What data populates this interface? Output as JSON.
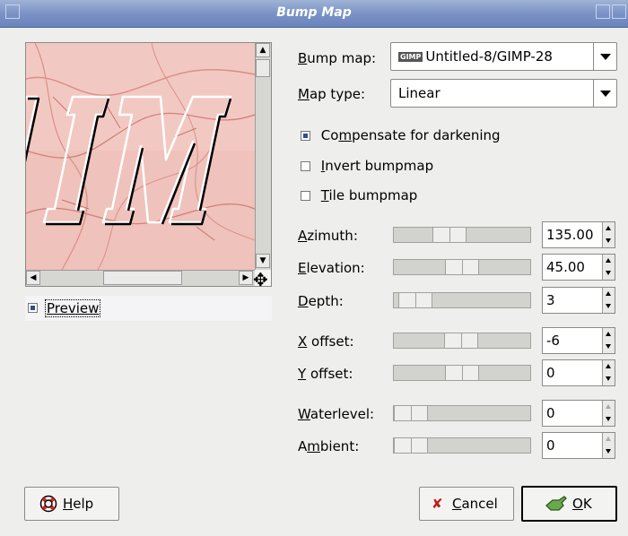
{
  "window": {
    "title": "Bump Map"
  },
  "preview": {
    "label": "Preview",
    "checked": true,
    "image_text": "IM"
  },
  "bump_map": {
    "label": "Bump map:",
    "label_key": "B",
    "label_rest": "ump map:",
    "badge": "GIMP",
    "value": "Untitled-8/GIMP-28"
  },
  "map_type": {
    "label_key": "M",
    "label_rest": "ap type:",
    "value": "Linear"
  },
  "options": {
    "compensate": {
      "pre": "Co",
      "key": "m",
      "post": "pensate for darkening",
      "checked": true
    },
    "invert": {
      "pre": "",
      "key": "I",
      "post": "nvert bumpmap",
      "checked": false
    },
    "tile": {
      "pre": "",
      "key": "T",
      "post": "ile bumpmap",
      "checked": false
    }
  },
  "params": {
    "azimuth": {
      "key": "A",
      "rest": "zimuth:",
      "value": "135.00",
      "fraction": 0.375
    },
    "elevation": {
      "key": "E",
      "rest": "levation:",
      "value": "45.00",
      "fraction": 0.5
    },
    "depth": {
      "key": "D",
      "rest": "epth:",
      "value": "3",
      "fraction": 0.04
    },
    "x_offset": {
      "key": "X",
      "rest": " offset:",
      "value": "-6",
      "fraction": 0.49
    },
    "y_offset": {
      "key": "Y",
      "rest": " offset:",
      "value": "0",
      "fraction": 0.5
    },
    "waterlevel": {
      "key": "W",
      "rest": "aterlevel:",
      "value": "0",
      "fraction": 0.0
    },
    "ambient": {
      "pre": "A",
      "key": "m",
      "rest": "bient:",
      "value": "0",
      "fraction": 0.0
    }
  },
  "buttons": {
    "help": {
      "key": "H",
      "rest": "elp"
    },
    "cancel": {
      "key": "C",
      "rest": "ancel"
    },
    "ok": {
      "key": "O",
      "rest": "K"
    }
  }
}
